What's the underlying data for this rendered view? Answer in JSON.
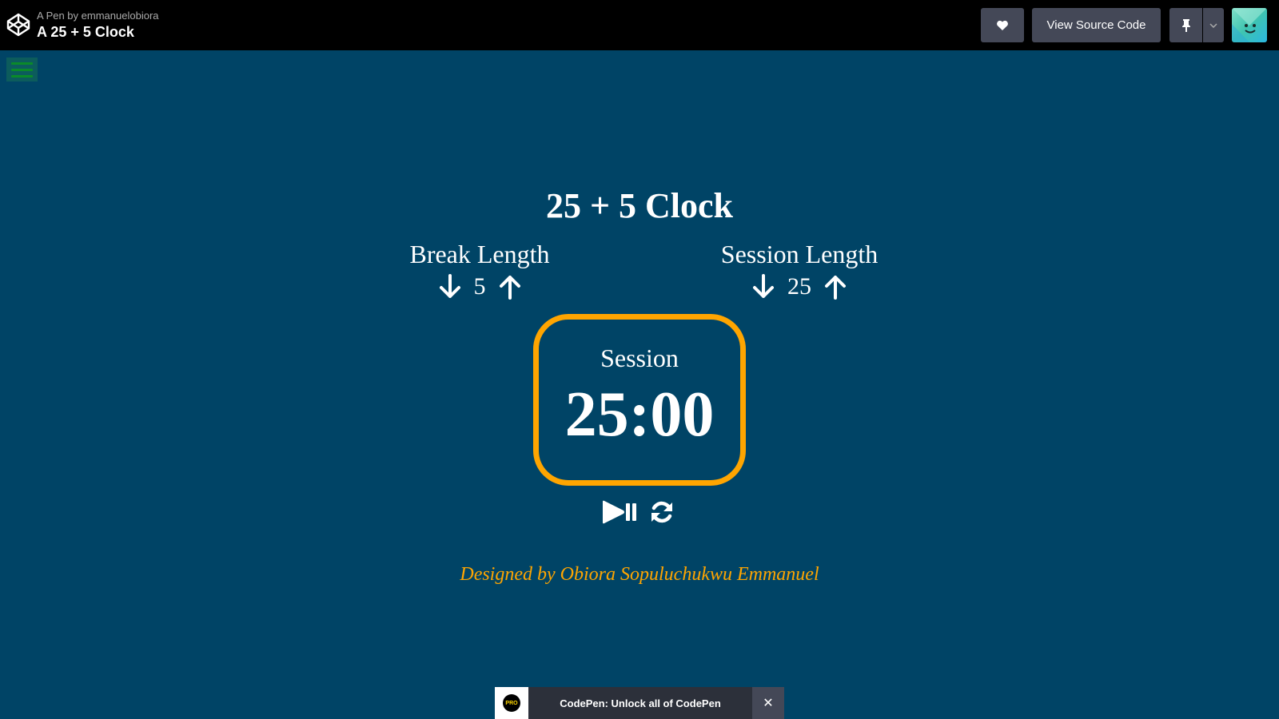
{
  "header": {
    "pen_by_prefix": "A Pen by",
    "author": "emmanuelobiora",
    "title": "A 25 + 5 Clock",
    "source_button_label": "View Source Code",
    "icons": [
      "codepen-logo-icon",
      "heart-icon",
      "pin-icon",
      "chevron-down-icon",
      "avatar"
    ]
  },
  "app": {
    "title": "25 + 5 Clock",
    "break": {
      "label": "Break Length",
      "value": "5"
    },
    "session": {
      "label": "Session Length",
      "value": "25"
    },
    "timer": {
      "label": "Session",
      "value": "25:00"
    },
    "credit": "Designed by Obiora Sopuluchukwu Emmanuel",
    "colors": {
      "background": "#004466",
      "accent": "#ffa500"
    }
  },
  "banner": {
    "badge": "PRO",
    "text": "CodePen: Unlock all of CodePen",
    "close": "✕"
  }
}
